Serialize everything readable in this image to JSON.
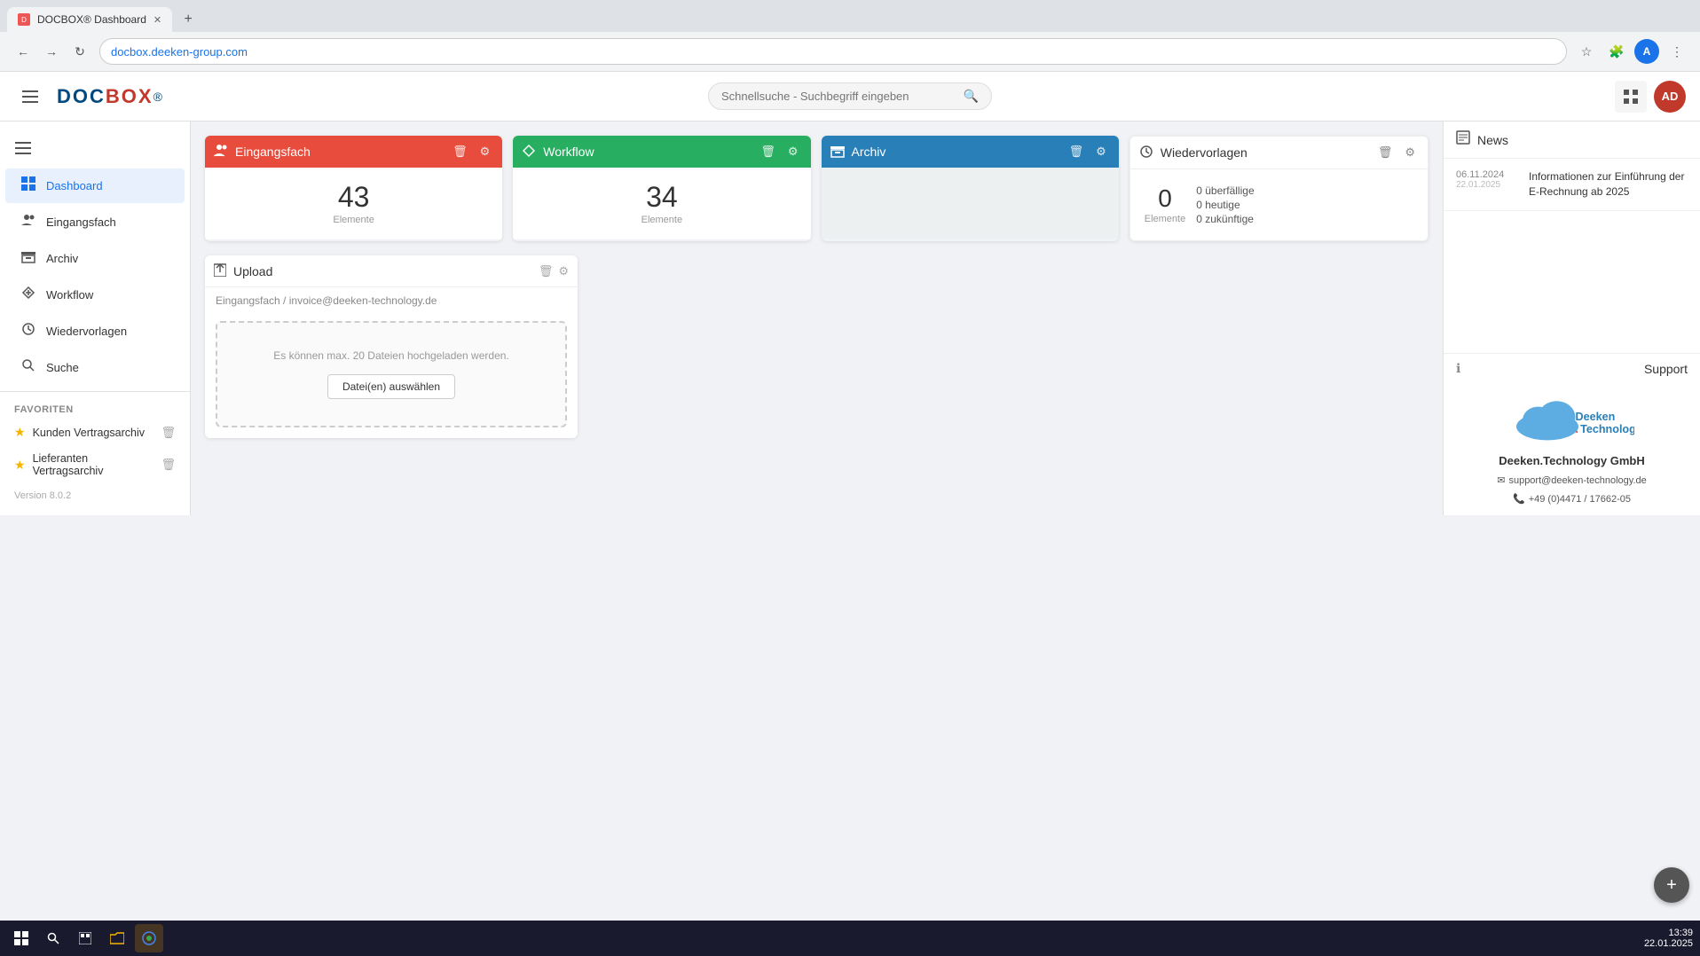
{
  "browser": {
    "tab_title": "DOCBOX® Dashboard",
    "tab_favicon": "D",
    "url": "docbox.deeken-group.com",
    "new_tab_label": "+"
  },
  "topbar": {
    "menu_icon": "☰",
    "logo": "DOC BOX®",
    "search_placeholder": "Schnellsuche - Suchbegriff eingeben",
    "search_icon": "🔍",
    "grid_icon": "⊞",
    "avatar_initials": "AD"
  },
  "sidebar": {
    "menu_icon": "☰",
    "items": [
      {
        "id": "dashboard",
        "label": "Dashboard",
        "icon": "⊟",
        "active": true
      },
      {
        "id": "eingangsfach",
        "label": "Eingangsfach",
        "icon": "👥",
        "active": false
      },
      {
        "id": "archiv",
        "label": "Archiv",
        "icon": "🗂",
        "active": false
      },
      {
        "id": "workflow",
        "label": "Workflow",
        "icon": "↗",
        "active": false
      },
      {
        "id": "wiedervorlagen",
        "label": "Wiedervorlagen",
        "icon": "◯",
        "active": false
      },
      {
        "id": "suche",
        "label": "Suche",
        "icon": "🔍",
        "active": false
      }
    ],
    "favoriten_label": "Favoriten",
    "favoriten": [
      {
        "id": "kunden",
        "label": "Kunden Vertragsarchiv"
      },
      {
        "id": "lieferanten",
        "label": "Lieferanten Vertragsarchiv"
      }
    ],
    "version": "Version 8.0.2"
  },
  "widgets": {
    "eingangsfach": {
      "title": "Eingangsfach",
      "icon": "👥",
      "count": "43",
      "count_label": "Elemente",
      "delete_btn": "🗑",
      "settings_btn": "⚙"
    },
    "workflow": {
      "title": "Workflow",
      "icon": "↗",
      "count": "34",
      "count_label": "Elemente",
      "delete_btn": "🗑",
      "settings_btn": "⚙"
    },
    "archiv": {
      "title": "Archiv",
      "icon": "🗂",
      "delete_btn": "🗑",
      "settings_btn": "⚙"
    },
    "wiedervorlagen": {
      "title": "Wiedervorlagen",
      "icon": "○",
      "count": "0",
      "count_label": "Elemente",
      "ueberfaellige_label": "0 überfällige",
      "heutige_label": "0 heutige",
      "zukuenftige_label": "0 zukünftige",
      "delete_btn": "🗑",
      "settings_btn": "⚙"
    }
  },
  "upload": {
    "title": "Upload",
    "icon": "📄",
    "delete_btn": "🗑",
    "settings_btn": "⚙",
    "path": "Eingangsfach / invoice@deeken-technology.de",
    "drop_hint": "Es können max. 20 Dateien hochgeladen werden.",
    "select_btn": "Datei(en) auswählen"
  },
  "news": {
    "title": "News",
    "icon": "📅",
    "items": [
      {
        "date": "06.11.2024",
        "date2": "22.01.2025",
        "text": "Informationen zur Einführung der E-Rechnung ab 2025"
      }
    ]
  },
  "support": {
    "title": "Support",
    "icon": "ℹ",
    "company": "Deeken.Technology GmbH",
    "email": "support@deeken-technology.de",
    "phone": "+49 (0)4471 / 17662-05",
    "logo_text": "Deeken.Technology"
  },
  "fab": {
    "icon": "+"
  },
  "taskbar": {
    "time": "13:39",
    "date": "22.01.2025"
  }
}
